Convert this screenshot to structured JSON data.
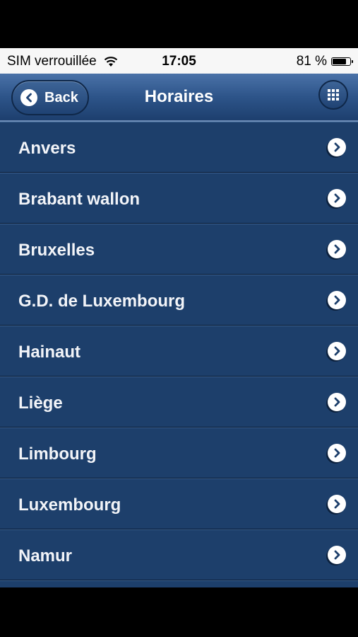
{
  "status_bar": {
    "carrier": "SIM verrouillée",
    "time": "17:05",
    "battery": "81 %",
    "battery_level": 0.81
  },
  "nav": {
    "back_label": "Back",
    "title": "Horaires",
    "menu_icon": "grid-icon"
  },
  "list": {
    "items": [
      {
        "label": "Anvers"
      },
      {
        "label": "Brabant wallon"
      },
      {
        "label": "Bruxelles"
      },
      {
        "label": "G.D. de Luxembourg"
      },
      {
        "label": "Hainaut"
      },
      {
        "label": "Liège"
      },
      {
        "label": "Limbourg"
      },
      {
        "label": "Luxembourg"
      },
      {
        "label": "Namur"
      }
    ]
  },
  "colors": {
    "nav_bar": "#2d5489",
    "list_item": "#1d3f6b",
    "text": "#f2f4f8"
  }
}
